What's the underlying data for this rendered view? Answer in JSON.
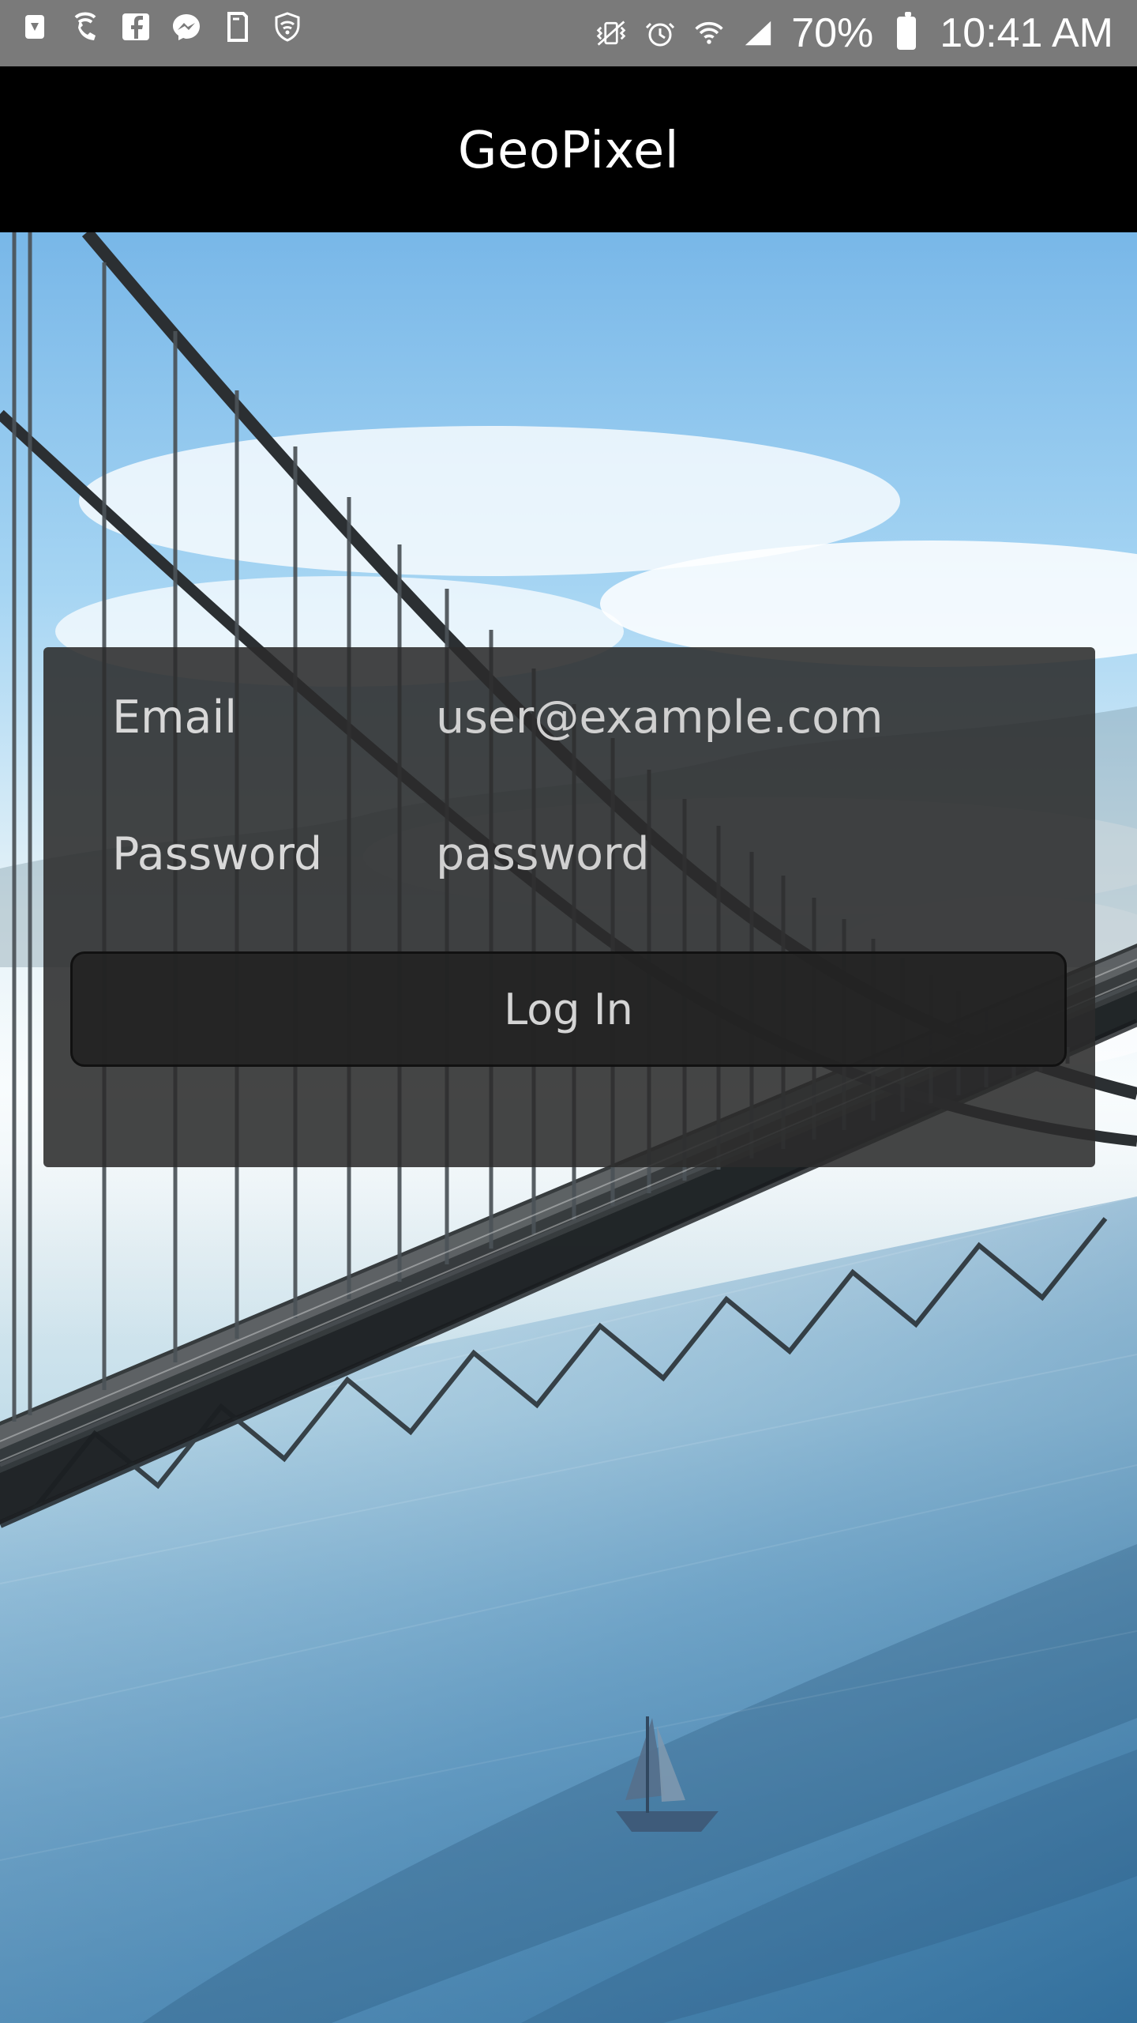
{
  "status_bar": {
    "left_icons": [
      "battery-saver-icon",
      "wifi-call-icon",
      "facebook-icon",
      "messenger-icon",
      "document-icon",
      "shield-wifi-icon"
    ],
    "right_icons": [
      "vibrate-icon",
      "alarm-icon",
      "wifi-icon",
      "signal-icon",
      "battery-icon"
    ],
    "battery_percent_text": "70%",
    "time": "10:41 AM"
  },
  "app_header": {
    "title": "GeoPixel"
  },
  "login_form": {
    "email_label": "Email",
    "email_value": "user@example.com",
    "password_label": "Password",
    "password_value": "password",
    "login_button_label": "Log In"
  },
  "colors": {
    "status_bar_bg": "#7a7a7a",
    "header_bg": "#000000",
    "panel_bg": "#2b2b2b",
    "button_bg": "#232323",
    "text_light": "#d8d8d8"
  }
}
